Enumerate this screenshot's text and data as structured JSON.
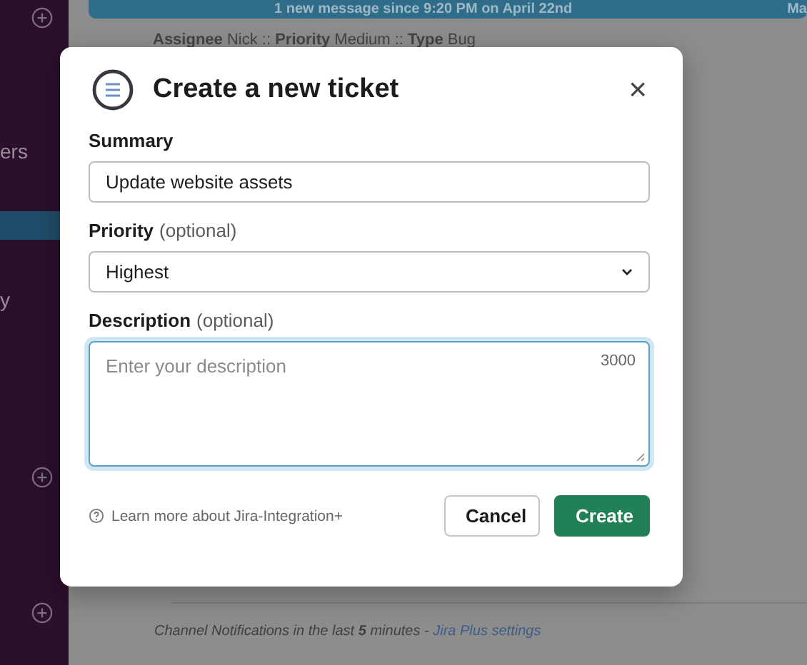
{
  "sidebar": {
    "items": [
      {
        "label": "ers",
        "selected": false
      },
      {
        "selected": true
      },
      {
        "label": "y",
        "selected": false
      }
    ]
  },
  "banner": {
    "text": "1 new message since 9:20 PM on April 22nd",
    "side_text": "Ma"
  },
  "ticket_meta": "**Assignee** Nick :: **Priority** Medium :: **Type** Bug",
  "footer_note": {
    "text": "Channel Notifications in the last **5** minutes - ",
    "link": "Jira Plus settings"
  },
  "dialog": {
    "title": "Create a new ticket",
    "close": "×",
    "fields": [
      {
        "kind": "text",
        "label": "Summary",
        "value": "Update website assets",
        "focused": false
      },
      {
        "kind": "select",
        "label": "Priority",
        "optional": "(optional)",
        "value": "Highest",
        "focused": false
      },
      {
        "kind": "textarea",
        "label": "Description",
        "optional": "(optional)",
        "placeholder": "Enter your description",
        "counter": "3000",
        "focused": true
      }
    ],
    "help_link": "Learn more about Jira-Integration+",
    "buttons": [
      {
        "kind": "secondary",
        "label": "Cancel"
      },
      {
        "kind": "primary",
        "label": "Create"
      }
    ]
  }
}
